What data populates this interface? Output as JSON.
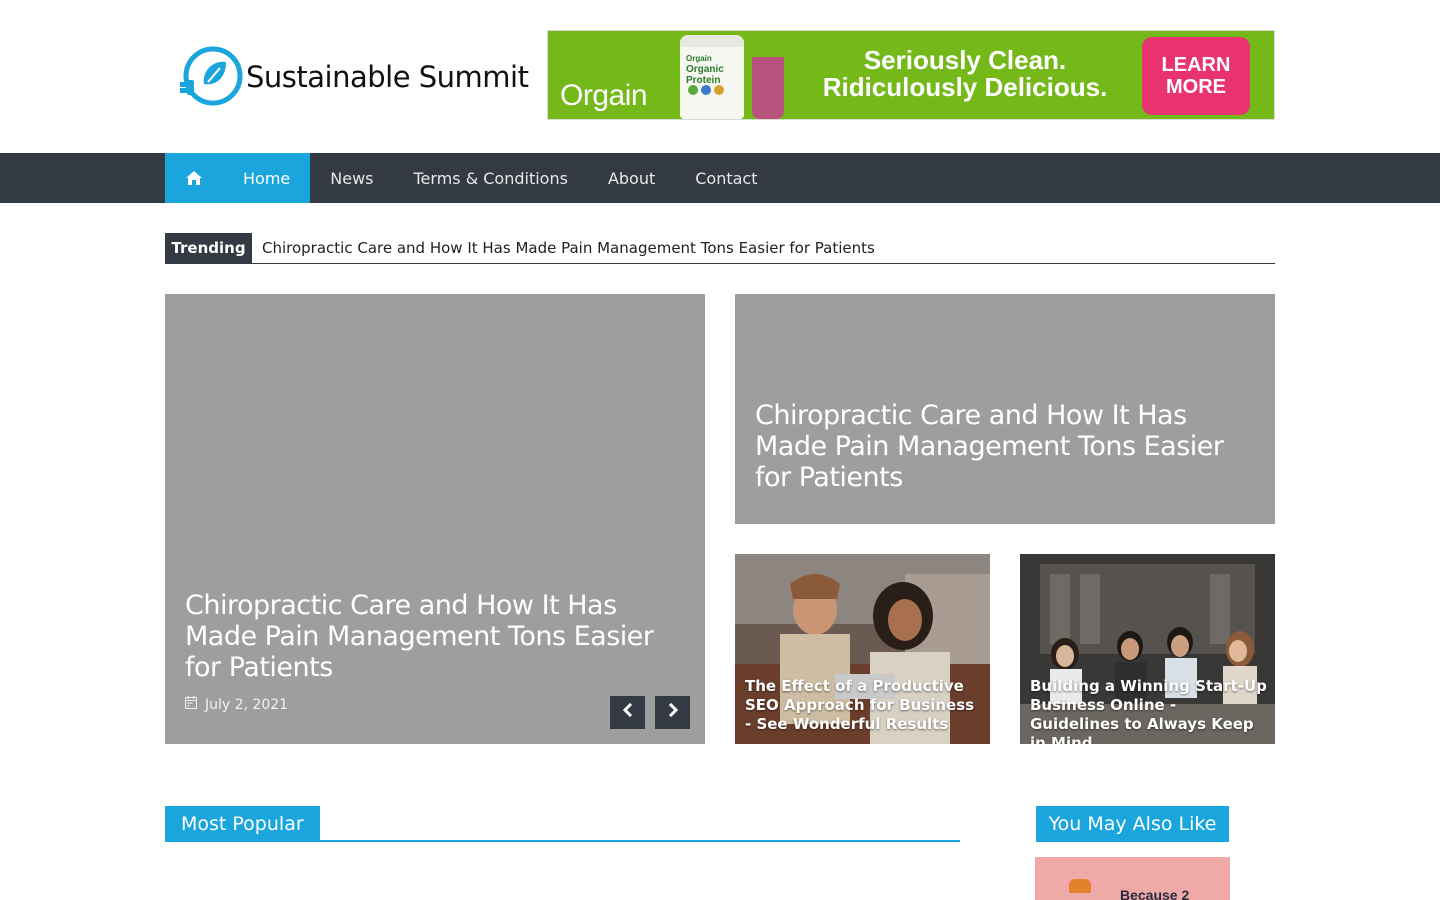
{
  "site": {
    "name": "Sustainable Summit"
  },
  "ad": {
    "brand": "Orgain",
    "product_label_line1": "Orgain",
    "product_label_line2": "Organic",
    "product_label_line3": "Protein",
    "headline_line1": "Seriously Clean.",
    "headline_line2": "Ridiculously Delicious.",
    "cta_line1": "LEARN",
    "cta_line2": "MORE",
    "bg_color": "#75b81a",
    "cta_color": "#e8336e"
  },
  "nav": {
    "home_icon": "home-icon",
    "items": [
      {
        "label": "Home",
        "active": true
      },
      {
        "label": "News",
        "active": false
      },
      {
        "label": "Terms & Conditions",
        "active": false
      },
      {
        "label": "About",
        "active": false
      },
      {
        "label": "Contact",
        "active": false
      }
    ],
    "accent_color": "#1aa6dd",
    "bar_color": "#343a43"
  },
  "trending": {
    "label": "Trending",
    "headline": "Chiropractic Care and How It Has Made Pain Management Tons Easier for Patients"
  },
  "featured": {
    "main": {
      "title": "Chiropractic Care and How It Has Made Pain Management Tons Easier for Patients",
      "date": "July 2, 2021",
      "date_icon": "calendar-icon",
      "prev_icon": "chevron-left-icon",
      "next_icon": "chevron-right-icon"
    },
    "top_right": {
      "title": "Chiropractic Care and How It Has Made Pain Management Tons Easier for Patients"
    },
    "small": [
      {
        "title": "The Effect of a Productive SEO Approach for Business - See Wonderful Results"
      },
      {
        "title": "Building a Winning Start-Up Business Online - Guidelines to Always Keep in Mind"
      }
    ]
  },
  "sections": {
    "most_popular": "Most Popular",
    "you_may_also_like": "You May Also Like",
    "ymal_thumb_text": "Because 2"
  }
}
